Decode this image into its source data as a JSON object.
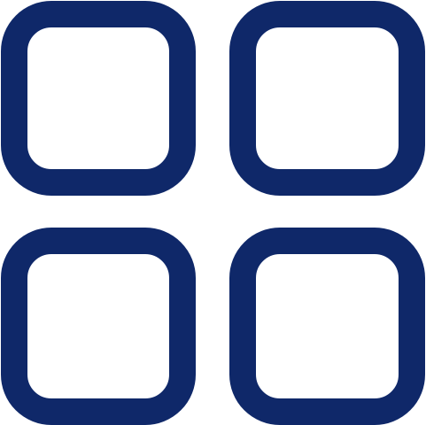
{
  "icon": {
    "name": "grid-icon",
    "color": "#0f2869"
  }
}
